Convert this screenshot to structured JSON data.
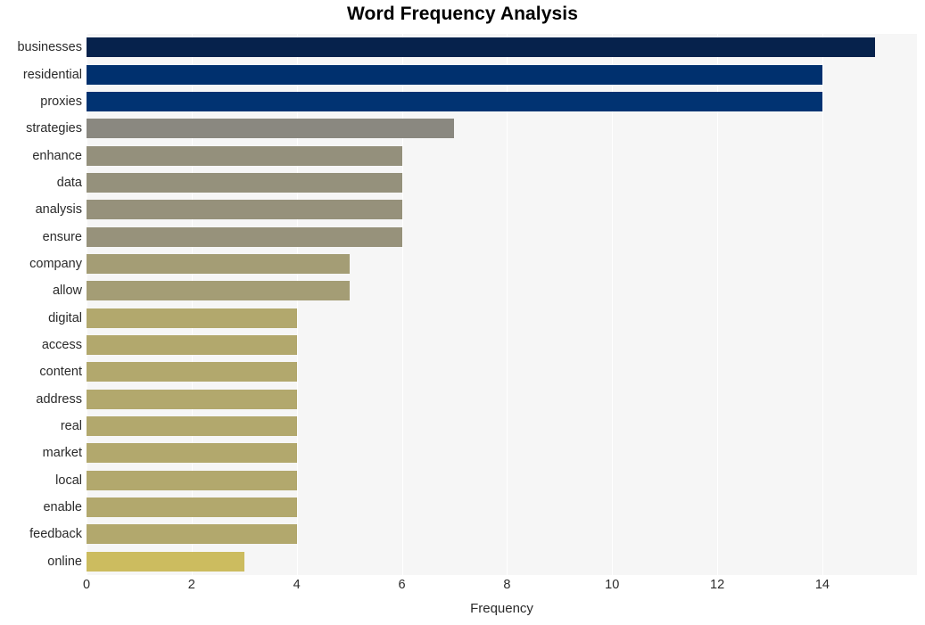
{
  "chart_data": {
    "type": "bar",
    "orientation": "horizontal",
    "title": "Word Frequency Analysis",
    "xlabel": "Frequency",
    "ylabel": "",
    "categories": [
      "businesses",
      "residential",
      "proxies",
      "strategies",
      "enhance",
      "data",
      "analysis",
      "ensure",
      "company",
      "allow",
      "digital",
      "access",
      "content",
      "address",
      "real",
      "market",
      "local",
      "enable",
      "feedback",
      "online"
    ],
    "values": [
      15,
      14,
      14,
      7,
      6,
      6,
      6,
      6,
      5,
      5,
      4,
      4,
      4,
      4,
      4,
      4,
      4,
      4,
      4,
      3
    ],
    "bar_colors": [
      "#06224c",
      "#00306e",
      "#013372",
      "#8a8880",
      "#94907c",
      "#95917c",
      "#96917b",
      "#97927b",
      "#a49d75",
      "#a49d75",
      "#b2a86d",
      "#b2a86d",
      "#b2a86d",
      "#b2a86d",
      "#b2a86d",
      "#b2a86d",
      "#b2a86d",
      "#b2a86d",
      "#b2a86d",
      "#ccbc5f"
    ],
    "xticks": [
      0,
      2,
      4,
      6,
      8,
      10,
      12,
      14
    ],
    "xlim": [
      0,
      15.8
    ],
    "grid": true,
    "grid_axis": "x",
    "legend": false,
    "plot_background": "#f6f6f6",
    "figure_background": "#ffffff"
  }
}
